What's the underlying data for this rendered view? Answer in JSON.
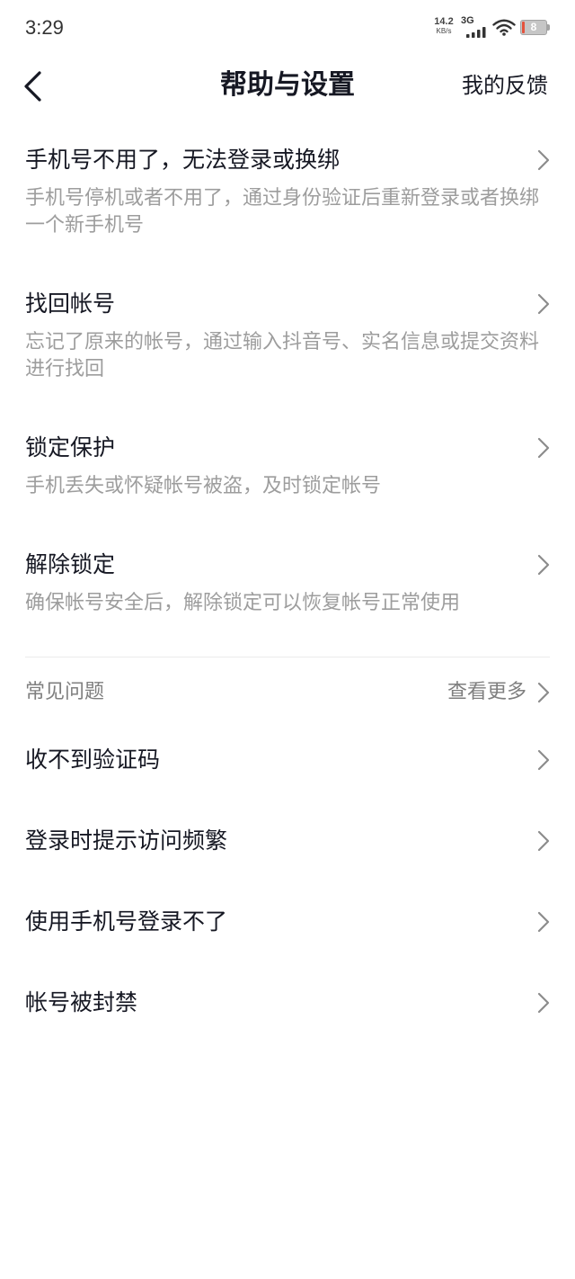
{
  "status_bar": {
    "time": "3:29",
    "net_speed": "14.2",
    "net_speed_unit": "KB/s",
    "network_type": "3G",
    "battery_level": "8",
    "icons": [
      "signal-icon",
      "wifi-icon",
      "battery-icon"
    ]
  },
  "header": {
    "back_icon": "chevron-left-icon",
    "title": "帮助与设置",
    "feedback_label": "我的反馈"
  },
  "account_items": [
    {
      "title": "手机号不用了，无法登录或换绑",
      "description": "手机号停机或者不用了，通过身份验证后重新登录或者换绑一个新手机号"
    },
    {
      "title": "找回帐号",
      "description": "忘记了原来的帐号，通过输入抖音号、实名信息或提交资料进行找回"
    },
    {
      "title": "锁定保护",
      "description": "手机丢失或怀疑帐号被盗，及时锁定帐号"
    },
    {
      "title": "解除锁定",
      "description": "确保帐号安全后，解除锁定可以恢复帐号正常使用"
    }
  ],
  "faq": {
    "title": "常见问题",
    "more_label": "查看更多",
    "items": [
      {
        "title": "收不到验证码"
      },
      {
        "title": "登录时提示访问频繁"
      },
      {
        "title": "使用手机号登录不了"
      },
      {
        "title": "帐号被封禁"
      }
    ]
  },
  "row_icon": "chevron-right-icon",
  "colors": {
    "background": "#ffffff",
    "text_primary": "#161823",
    "text_secondary": "#9d9d9d",
    "section_label": "#7f7f7f",
    "chevron": "#8c8c8c",
    "divider": "#ececec",
    "battery_low": "#e4533d"
  }
}
